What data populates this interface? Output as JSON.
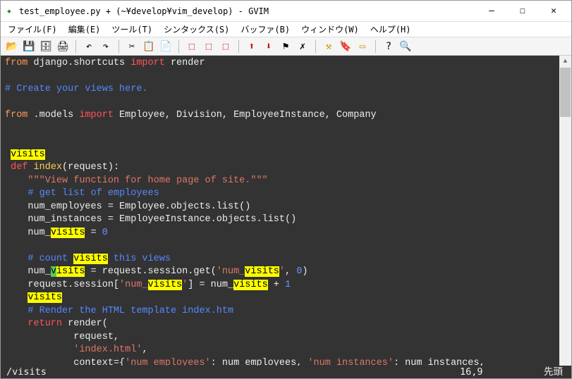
{
  "window": {
    "title": "test_employee.py + (~¥develop¥vim_develop) - GVIM",
    "min": "—",
    "max": "☐",
    "close": "✕"
  },
  "menus": [
    {
      "t": "ファイル(F)",
      "k": "F"
    },
    {
      "t": "編集(E)",
      "k": "E"
    },
    {
      "t": "ツール(T)",
      "k": "T"
    },
    {
      "t": "シンタックス(S)",
      "k": "S"
    },
    {
      "t": "バッファ(B)",
      "k": "B"
    },
    {
      "t": "ウィンドウ(W)",
      "k": "W"
    },
    {
      "t": "ヘルプ(H)",
      "k": "H"
    }
  ],
  "toolbar_icons": [
    "open",
    "save",
    "saveall",
    "print",
    "|",
    "undo",
    "redo",
    "|",
    "cut",
    "copy",
    "paste",
    "|",
    "replace",
    "findnext",
    "findprev",
    "|",
    "load",
    "save2",
    "run",
    "make",
    "|",
    "jump",
    "tag",
    "help",
    "|",
    "help2",
    "find"
  ],
  "code": {
    "l1_from": "from",
    "l1_mod": " django.shortcuts ",
    "l1_imp": "import",
    "l1_rest": " render",
    "l3": "# Create your views here.",
    "l5_from": "from",
    "l5_mod": " .models ",
    "l5_imp": "import",
    "l5_rest": " Employee, Division, EmployeeInstance, Company",
    "l8_hl": "visits",
    "l9_def": "def",
    "l9_fn": " index",
    "l9_rest": "(request):",
    "l10": "    \"\"\"View function for home page of site.\"\"\"",
    "l11": "    # get list of employees",
    "l12a": "    num_employees ",
    "l12eq": "=",
    "l12b": " Employee.objects.list()",
    "l13a": "    num_instances ",
    "l13eq": "=",
    "l13b": " EmployeeInstance.objects.list()",
    "l14a": "    num_",
    "l14hl": "visits",
    "l14eq": " = ",
    "l14n": "0",
    "l16a": "    # count ",
    "l16hl": "visits",
    "l16b": " this views",
    "l17a": "    num_",
    "l17g": "v",
    "l17hl": "isits",
    "l17b": " = request.session.get(",
    "l17s1": "'num_",
    "l17s1hl": "visits",
    "l17s1b": "'",
    "l17c": ", ",
    "l17n": "0",
    "l17d": ")",
    "l18a": "    request.session[",
    "l18s1": "'num_",
    "l18s1hl": "visits",
    "l18s2": "'",
    "l18b": "] = num_",
    "l18hl": "visits",
    "l18c": " + ",
    "l18n": "1",
    "l19hl": "visits",
    "l20": "    # Render the HTML template index.htm",
    "l21_ret": "    return",
    "l21_fn": " render",
    "l21_b": "(",
    "l22": "            request,",
    "l23a": "            ",
    "l23s": "'index.html'",
    "l23b": ",",
    "l24a": "            context={",
    "l24s1": "'num_employees'",
    "l24b": ": num_employees, ",
    "l24s2": "'num_instances'",
    "l24c": ": num_instances,"
  },
  "status": {
    "cmd": "/visits",
    "pos": "16,9",
    "pct": "先頭"
  }
}
